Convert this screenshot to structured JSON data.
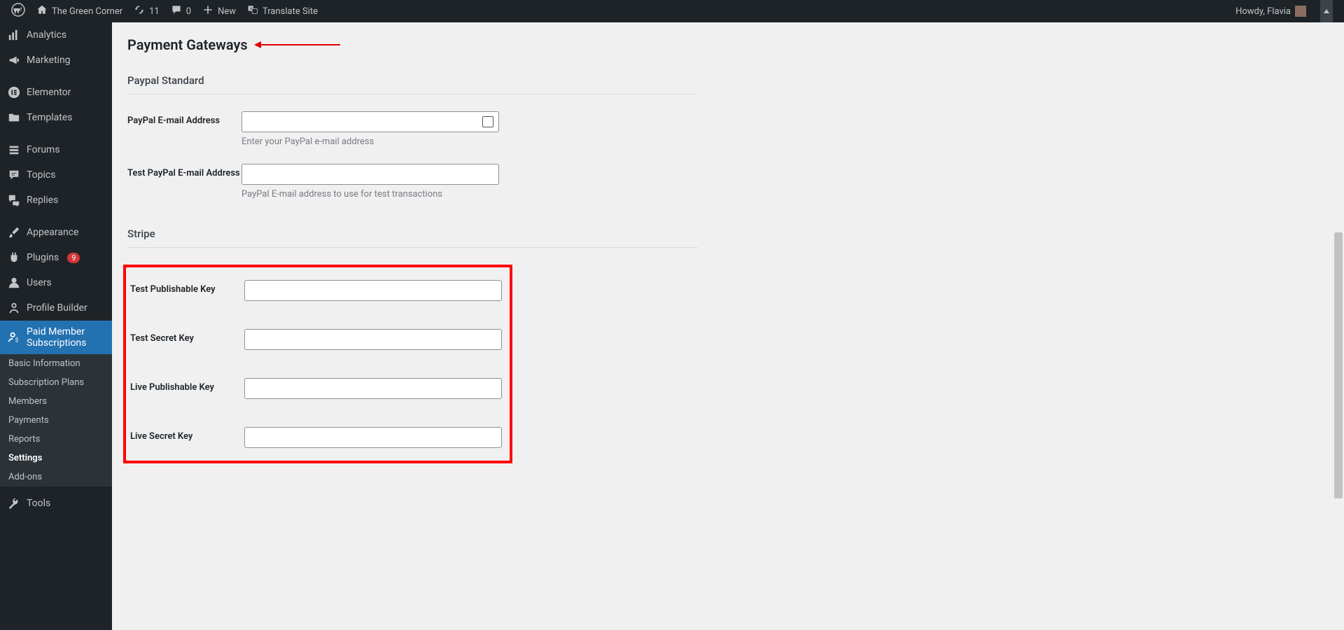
{
  "adminbar": {
    "site_name": "The Green Corner",
    "updates_count": "11",
    "comments_count": "0",
    "new_label": "New",
    "translate_label": "Translate Site",
    "howdy": "Howdy, Flavia"
  },
  "sidebar": {
    "items": [
      {
        "label": "Analytics"
      },
      {
        "label": "Marketing"
      },
      {
        "label": "Elementor"
      },
      {
        "label": "Templates"
      },
      {
        "label": "Forums"
      },
      {
        "label": "Topics"
      },
      {
        "label": "Replies"
      },
      {
        "label": "Appearance"
      },
      {
        "label": "Plugins",
        "badge": "9"
      },
      {
        "label": "Users"
      },
      {
        "label": "Profile Builder"
      },
      {
        "label": "Paid Member Subscriptions"
      },
      {
        "label": "Tools"
      }
    ],
    "submenu": [
      {
        "label": "Basic Information"
      },
      {
        "label": "Subscription Plans"
      },
      {
        "label": "Members"
      },
      {
        "label": "Payments"
      },
      {
        "label": "Reports"
      },
      {
        "label": "Settings"
      },
      {
        "label": "Add-ons"
      }
    ]
  },
  "page": {
    "title": "Payment Gateways",
    "sections": {
      "paypal": {
        "heading": "Paypal Standard",
        "email_label": "PayPal E-mail Address",
        "email_desc": "Enter your PayPal e-mail address",
        "test_email_label": "Test PayPal E-mail Address",
        "test_email_desc": "PayPal E-mail address to use for test transactions"
      },
      "stripe": {
        "heading": "Stripe",
        "test_pub_label": "Test Publishable Key",
        "test_secret_label": "Test Secret Key",
        "live_pub_label": "Live Publishable Key",
        "live_secret_label": "Live Secret Key"
      }
    }
  }
}
